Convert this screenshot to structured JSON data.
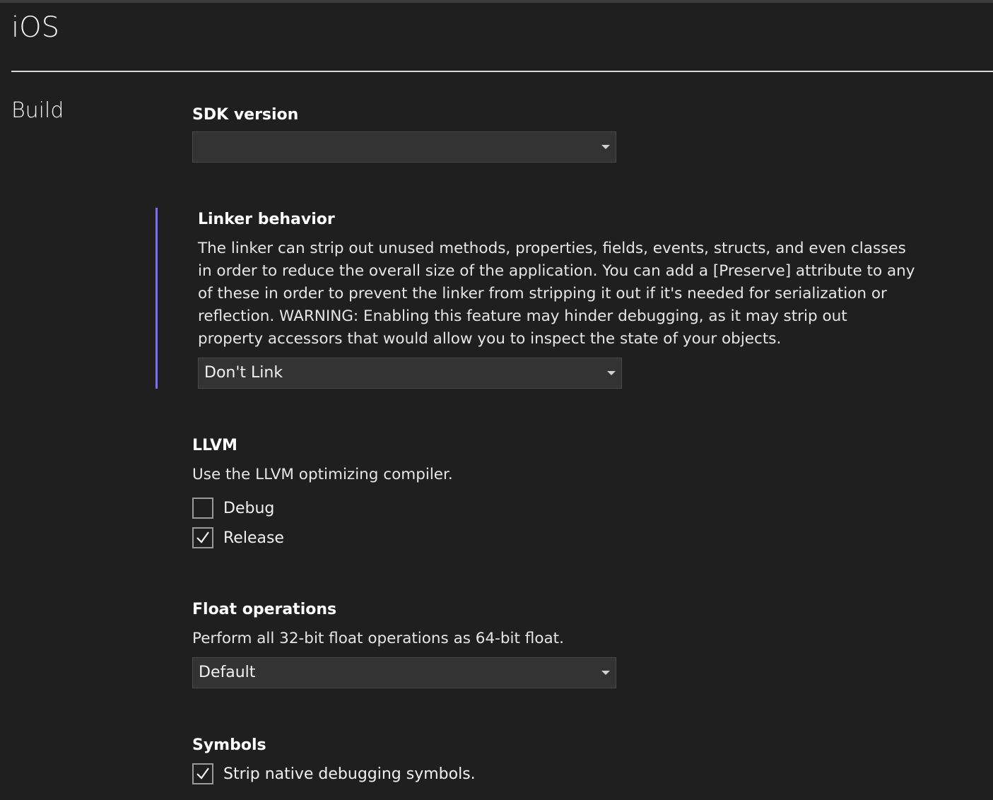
{
  "page": {
    "title": "iOS",
    "section_title": "Build"
  },
  "sdk_version": {
    "label": "SDK version",
    "value": ""
  },
  "linker": {
    "label": "Linker behavior",
    "description_lines": [
      "The linker can strip out unused methods, properties, fields, events, structs, and even classes",
      "in order to reduce the overall size of the application. You can add a [Preserve] attribute to any",
      "of these in order to prevent the linker from stripping it out if it's needed for serialization or",
      "reflection. WARNING: Enabling this feature may hinder debugging, as it may strip out",
      "property accessors that would allow you to inspect the state of your objects."
    ],
    "value": "Don't Link",
    "accent_color": "#7b6ff2"
  },
  "llvm": {
    "label": "LLVM",
    "description": "Use the LLVM optimizing compiler.",
    "options": [
      {
        "label": "Debug",
        "checked": false
      },
      {
        "label": "Release",
        "checked": true
      }
    ]
  },
  "float_operations": {
    "label": "Float operations",
    "description": "Perform all 32-bit float operations as 64-bit float.",
    "value": "Default"
  },
  "symbols": {
    "label": "Symbols",
    "options": [
      {
        "label": "Strip native debugging symbols.",
        "checked": true
      }
    ]
  },
  "icons": {
    "dropdown": "chevron-down-icon",
    "checkbox_checked": "checkmark-icon"
  }
}
